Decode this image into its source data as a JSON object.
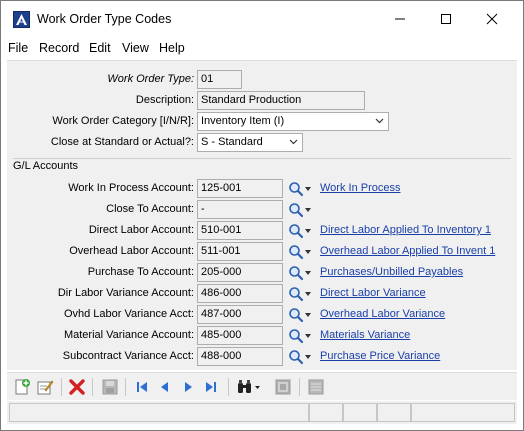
{
  "window": {
    "title": "Work Order Type Codes"
  },
  "menu": {
    "file": "File",
    "record": "Record",
    "edit": "Edit",
    "view": "View",
    "help": "Help"
  },
  "form": {
    "work_order_type": {
      "label": "Work Order Type:",
      "value": "01"
    },
    "description": {
      "label": "Description:",
      "value": "Standard Production"
    },
    "category": {
      "label": "Work Order Category [I/N/R]:",
      "value": "Inventory Item (I)"
    },
    "close_at": {
      "label": "Close at Standard or Actual?:",
      "value": "S - Standard"
    }
  },
  "gl": {
    "section_label": "G/L Accounts",
    "accounts": [
      {
        "label": "Work In Process Account:",
        "value": "125-001",
        "link": "Work In Process"
      },
      {
        "label": "Close To Account:",
        "value": "-",
        "link": ""
      },
      {
        "label": "Direct Labor Account:",
        "value": "510-001",
        "link": "Direct Labor Applied To Inventory 1"
      },
      {
        "label": "Overhead Labor Account:",
        "value": "511-001",
        "link": "Overhead Labor Applied To Invent 1"
      },
      {
        "label": "Purchase To Account:",
        "value": "205-000",
        "link": "Purchases/Unbilled Payables"
      },
      {
        "label": "Dir Labor Variance Account:",
        "value": "486-000",
        "link": "Direct Labor Variance"
      },
      {
        "label": "Ovhd Labor Variance Acct:",
        "value": "487-000",
        "link": "Overhead Labor Variance"
      },
      {
        "label": "Material Variance Account:",
        "value": "485-000",
        "link": "Materials Variance"
      },
      {
        "label": "Subcontract Variance Acct:",
        "value": "488-000",
        "link": "Purchase Price Variance"
      }
    ]
  },
  "toolbar": {
    "icons": [
      "new-record-icon",
      "edit-record-icon",
      "delete-icon",
      "save-icon",
      "first-record-icon",
      "previous-record-icon",
      "next-record-icon",
      "last-record-icon",
      "binoculars-icon",
      "notes-icon",
      "list-icon"
    ]
  },
  "colors": {
    "link": "#1a3fa8",
    "delete": "#d42020",
    "nav": "#2d6fd4",
    "app_icon": "#1e3f8c"
  }
}
